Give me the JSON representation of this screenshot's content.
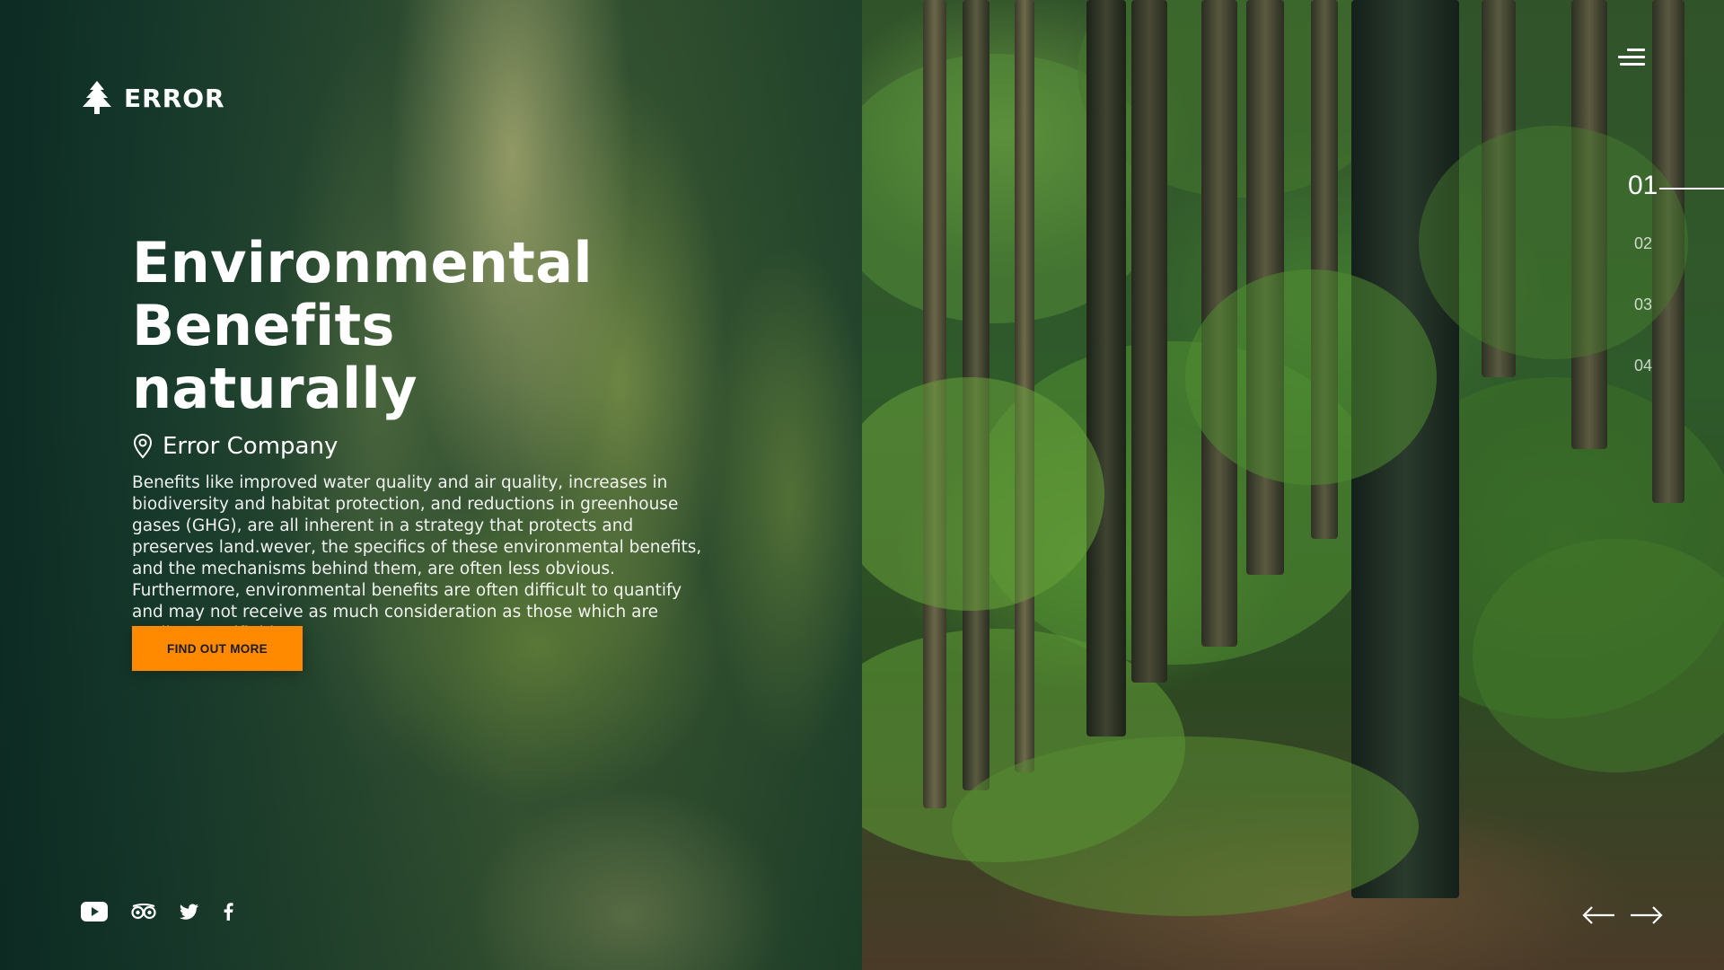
{
  "brand": {
    "name": "ERROR",
    "icon": "pine-tree-icon"
  },
  "hero": {
    "title_line1": "Environmental Benefits",
    "title_line2": "naturally",
    "location": "Error Company",
    "location_icon": "map-pin-icon",
    "description": "Benefits like improved water quality and air quality, increases in biodiversity and habitat protection, and reductions in greenhouse gases (GHG), are all inherent in a strategy that protects and preserves land.wever, the specifics of these environmental benefits, and the mechanisms behind them, are often less obvious. Furthermore, environmental benefits are often difficult to quantify and may not receive as much consideration as those which are easily quantifiable.",
    "cta_label": "FIND OUT MORE"
  },
  "pagination": {
    "items": [
      "01",
      "02",
      "03",
      "04"
    ],
    "active_index": 0
  },
  "menu": {
    "icon": "hamburger-menu-icon"
  },
  "social": [
    {
      "name": "youtube",
      "icon": "youtube-icon"
    },
    {
      "name": "tripadvisor",
      "icon": "tripadvisor-icon"
    },
    {
      "name": "twitter",
      "icon": "twitter-icon"
    },
    {
      "name": "facebook",
      "icon": "facebook-icon"
    }
  ],
  "navigation": {
    "prev_icon": "arrow-left-icon",
    "next_icon": "arrow-right-icon"
  },
  "colors": {
    "accent": "#ff8a00",
    "panel_dark": "#0e2a22",
    "text": "#ffffff"
  }
}
